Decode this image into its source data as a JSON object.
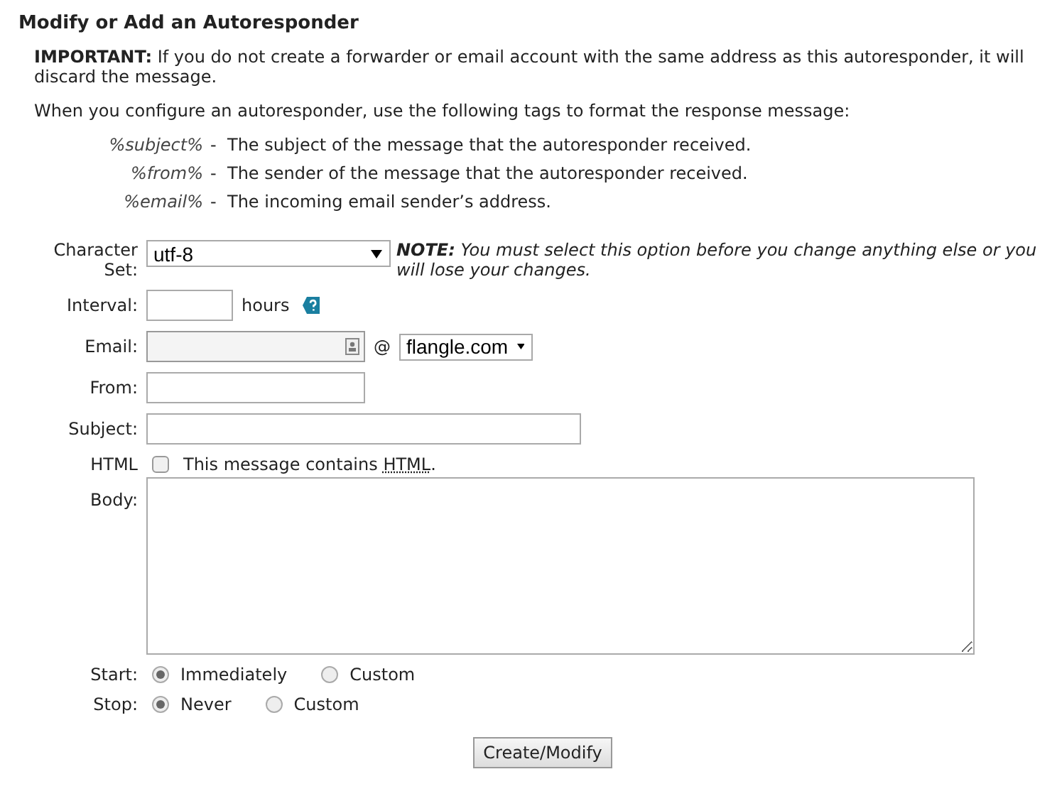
{
  "title": "Modify or Add an Autoresponder",
  "important": "**IMPORTANT:** If you do not create a forwarder or email account with the same address as this autoresponder, it will discard the message.",
  "intro": "When you configure an autoresponder, use the following tags to format the response message:",
  "tags": [
    {
      "tag": "%subject%",
      "dash": "-",
      "description": "The subject of the message that the autoresponder received."
    },
    {
      "tag": "%from%",
      "dash": "-",
      "description": "The sender of the message that the autoresponder received."
    },
    {
      "tag": "%email%",
      "dash": "-",
      "description": "The incoming email sender’s address."
    }
  ],
  "form": {
    "charset": {
      "label": "Character Set:",
      "value": "utf-8",
      "note": "**NOTE:** You must select this option before you change anything else or you will lose your changes."
    },
    "interval": {
      "label": "Interval:",
      "unit": "hours"
    },
    "email": {
      "label": "Email:",
      "at": "@",
      "domain": "flangle.com"
    },
    "from": {
      "label": "From:"
    },
    "subject": {
      "label": "Subject:"
    },
    "html": {
      "label": "HTML",
      "checked": false,
      "text": "This message contains ",
      "abbr": "HTML",
      "end": "."
    },
    "body": {
      "label": "Body:"
    },
    "radios": [
      {
        "label": "Start:",
        "options": [
          {
            "label": "Immediately",
            "selected": true
          },
          {
            "label": "Custom",
            "selected": false
          }
        ]
      },
      {
        "label": "Stop:",
        "options": [
          {
            "label": "Never",
            "selected": true
          },
          {
            "label": "Custom",
            "selected": false
          }
        ]
      }
    ],
    "button": "Create/Modify"
  }
}
